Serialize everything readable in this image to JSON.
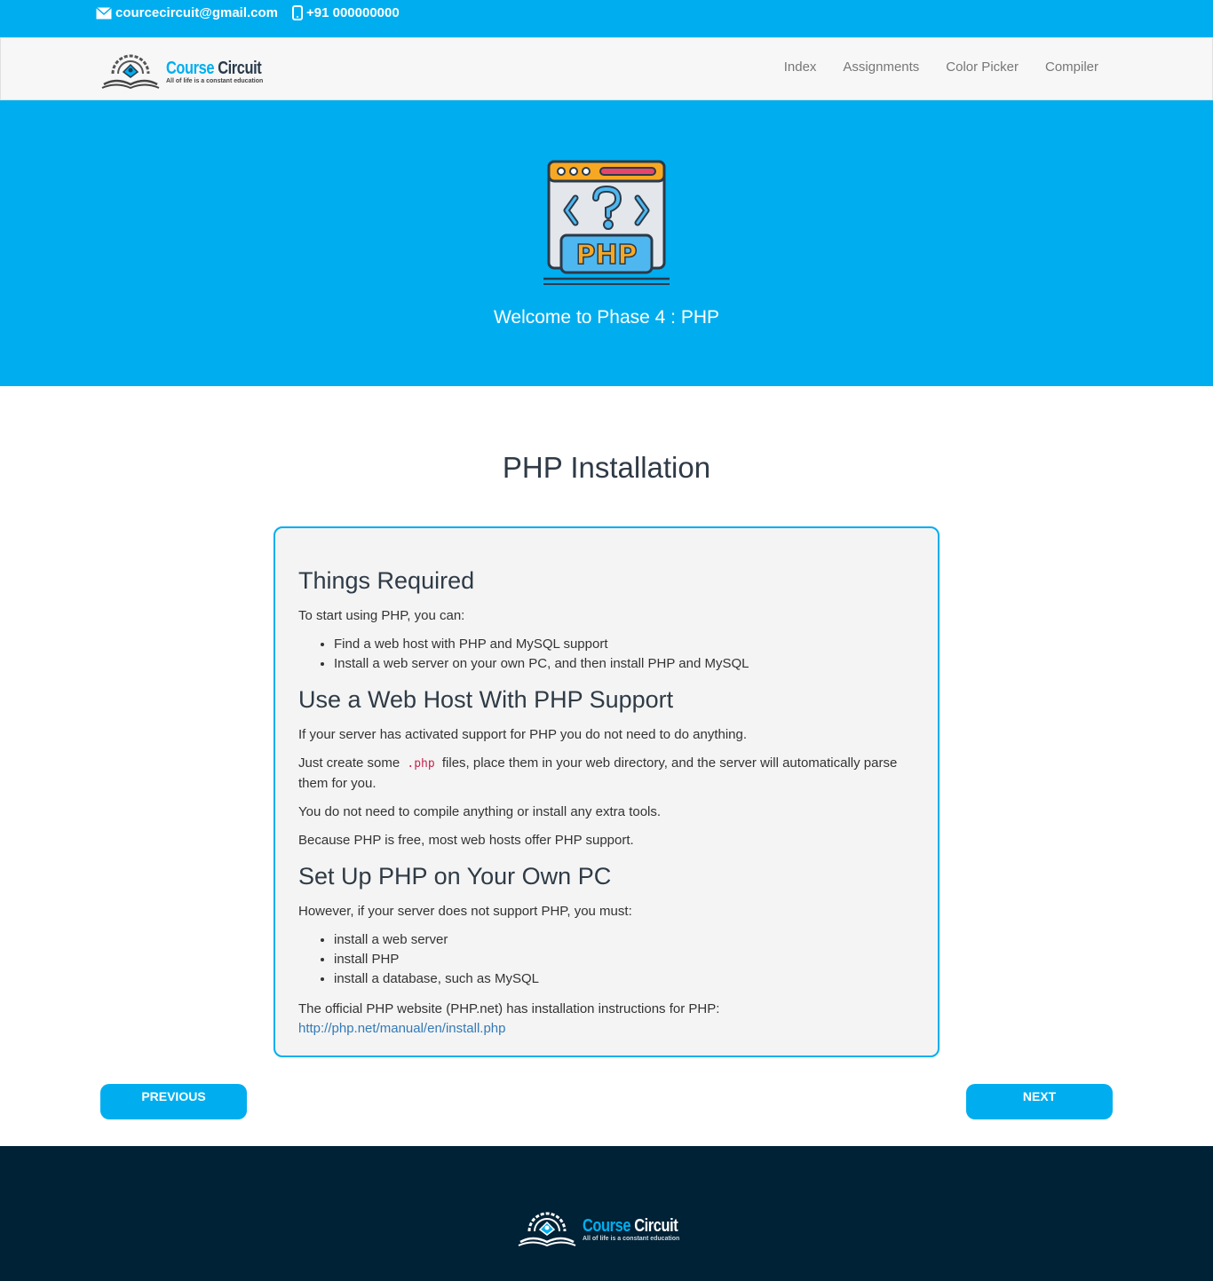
{
  "topbar": {
    "email": "courcecircuit@gmail.com",
    "phone": "+91 000000000"
  },
  "brand": {
    "name_part1": "Course",
    "name_part2": "Circuit",
    "tagline": "All of life is a constant education"
  },
  "nav": {
    "items": [
      {
        "label": "Index"
      },
      {
        "label": "Assignments"
      },
      {
        "label": "Color Picker"
      },
      {
        "label": "Compiler"
      }
    ]
  },
  "hero": {
    "icon_label": "PHP",
    "welcome": "Welcome to Phase 4 : PHP"
  },
  "main": {
    "title": "PHP Installation",
    "section1": {
      "heading": "Things Required",
      "intro": "To start using PHP, you can:",
      "items": [
        "Find a web host with PHP and MySQL support",
        "Install a web server on your own PC, and then install PHP and MySQL"
      ]
    },
    "section2": {
      "heading": "Use a Web Host With PHP Support",
      "p1": "If your server has activated support for PHP you do not need to do anything.",
      "p2_before": "Just create some",
      "p2_code": ".php",
      "p2_after": "files, place them in your web directory, and the server will automatically parse them for you.",
      "p3": "You do not need to compile anything or install any extra tools.",
      "p4": "Because PHP is free, most web hosts offer PHP support."
    },
    "section3": {
      "heading": "Set Up PHP on Your Own PC",
      "intro": "However, if your server does not support PHP, you must:",
      "items": [
        "install a web server",
        "install PHP",
        "install a database, such as MySQL"
      ],
      "outro": "The official PHP website (PHP.net) has installation instructions for PHP:",
      "link": "http://php.net/manual/en/install.php"
    }
  },
  "buttons": {
    "previous": "PREVIOUS",
    "next": "NEXT"
  },
  "colors": {
    "accent": "#00aeef",
    "footer_bg": "#002236"
  }
}
